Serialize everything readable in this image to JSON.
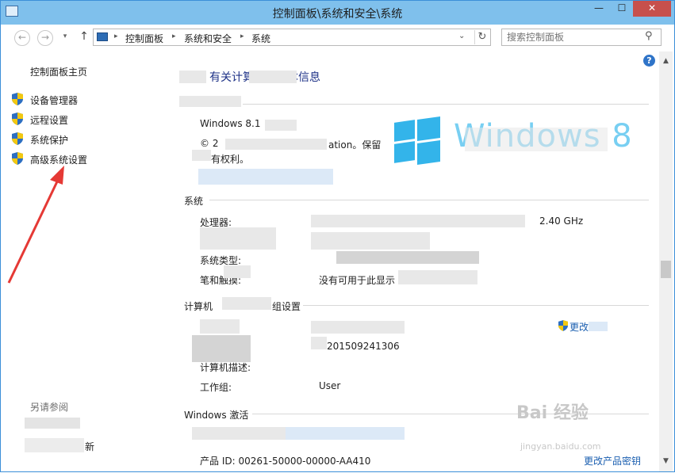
{
  "window": {
    "title": "控制面板\\系统和安全\\系统",
    "min_label": "—",
    "max_label": "☐",
    "close_label": "✕"
  },
  "nav": {
    "back": "←",
    "forward": "→",
    "history": "▾",
    "up": "↑",
    "breadcrumbs": [
      "控制面板",
      "系统和安全",
      "系统"
    ],
    "crumb_sep": "▸",
    "dropdown": "⌄",
    "refresh": "↻",
    "search_placeholder": "搜索控制面板",
    "search_icon": "⚲"
  },
  "sidebar": {
    "home": "控制面板主页",
    "items": [
      {
        "label": "设备管理器",
        "icon": "shield-icon"
      },
      {
        "label": "远程设置",
        "icon": "shield-icon"
      },
      {
        "label": "系统保护",
        "icon": "shield-icon"
      },
      {
        "label": "高级系统设置",
        "icon": "shield-icon"
      }
    ],
    "see_also": "另请参阅",
    "new_suffix": "新"
  },
  "main": {
    "heading_tail": "有关计算机的基本信息",
    "edition_name": "Windows 8.1",
    "copyright_frag1": "© 2",
    "copyright_frag2": "ation。保留",
    "copyright_frag3": "有权利。",
    "brand_text": "Windows 8",
    "system_header": "系统",
    "processor_label": "处理器:",
    "processor_value_tail": "2.40 GHz",
    "system_type_label": "系统类型:",
    "pen_label": "笔和触摸:",
    "pen_value": "没有可用于此显示",
    "computer_header": "计算机",
    "computer_header_tail": "组设置",
    "change_settings_link": "更改",
    "computer_name_value_tail": "201509241306",
    "description_label": "计算机描述:",
    "workgroup_label": "工作组:",
    "workgroup_value": "User",
    "activation_header": "Windows 激活",
    "product_id": "产品 ID: 00261-50000-00000-AA410",
    "change_key_link": "更改产品密钥"
  },
  "help_icon": "?",
  "watermark": "Bai 经验",
  "watermark_url": "jingyan.baidu.com",
  "colors": {
    "titlebar": "#7fc0ec",
    "close": "#c7504c",
    "link": "#1b5fb0",
    "win_blue": "#33b4ea",
    "arrow_red": "#e53935"
  }
}
